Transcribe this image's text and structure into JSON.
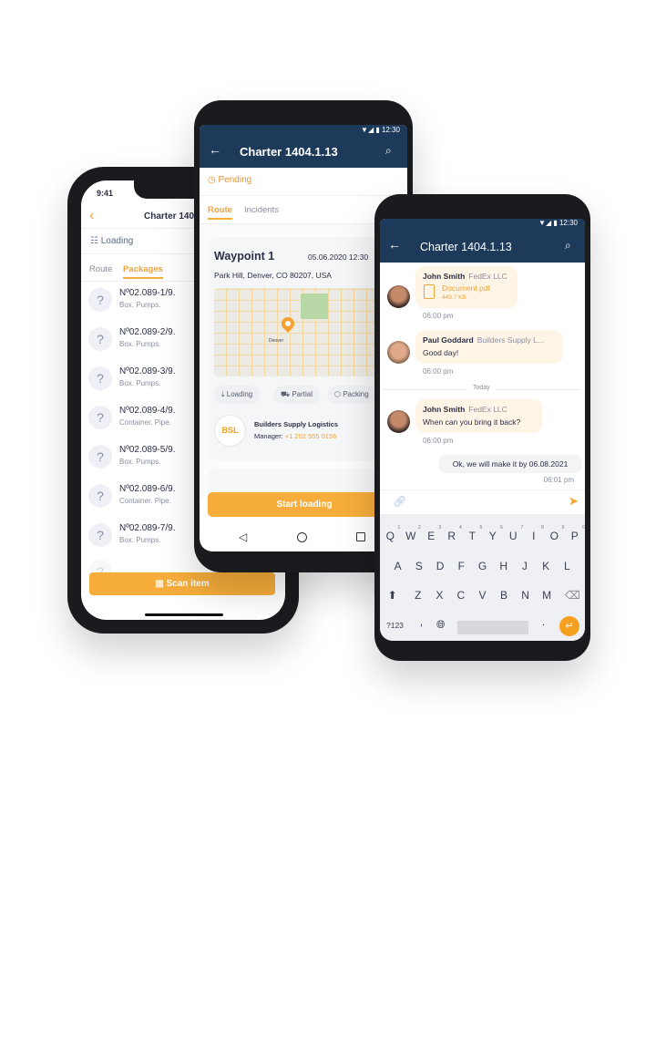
{
  "colors": {
    "accent": "#f6ad3b",
    "header": "#1d3a5b",
    "text": "#2a2f45",
    "muted": "#8a8fa3",
    "bubble": "#fff5e6"
  },
  "left_phone": {
    "time": "9:41",
    "title": "Charter 1404.1.13",
    "status": "Loading",
    "tabs": [
      {
        "label": "Route",
        "active": false
      },
      {
        "label": "Packages",
        "active": true
      }
    ],
    "packages": [
      {
        "id": "Nº02.089-1/9.",
        "desc": "Box. Pumps."
      },
      {
        "id": "Nº02.089-2/9.",
        "desc": "Box. Pumps."
      },
      {
        "id": "Nº02.089-3/9.",
        "desc": "Box. Pumps."
      },
      {
        "id": "Nº02.089-4/9.",
        "desc": "Container. Pipe."
      },
      {
        "id": "Nº02.089-5/9.",
        "desc": "Box. Pumps."
      },
      {
        "id": "Nº02.089-6/9.",
        "desc": "Container. Pipe."
      },
      {
        "id": "Nº02.089-7/9.",
        "desc": "Box. Pumps."
      }
    ],
    "scan_button": "Scan item"
  },
  "middle_phone": {
    "status_time": "12:30",
    "title": "Charter 1404.1.13",
    "status": "Pending",
    "tabs": [
      {
        "label": "Route",
        "active": true
      },
      {
        "label": "Incidents",
        "active": false
      }
    ],
    "waypoint": {
      "name": "Waypoint 1",
      "datetime": "05.06.2020 12:30",
      "address": "Park Hill, Denver, CO 80207, USA",
      "map_label": "Denver",
      "chips": [
        "Loading",
        "Partial",
        "Packing"
      ],
      "company": "Builders Supply Logistics",
      "manager_label": "Manager:",
      "manager_phone": "+1 202 555 0156",
      "logo": "BSL"
    },
    "start_button": "Start loading"
  },
  "right_phone": {
    "status_time": "12:30",
    "title": "Charter 1404.1.13",
    "messages": [
      {
        "name": "John Smith",
        "company": "FedEx LLC",
        "file": "Document.pdf",
        "size": "449.7 KB",
        "time": "06:00 pm"
      },
      {
        "name": "Paul Goddard",
        "company": "Builders Supply L...",
        "text": "Good day!",
        "time": "06:00 pm"
      },
      {
        "name": "John Smith",
        "company": "FedEx LLC",
        "text": "When can you bring it back?",
        "time": "06:00 pm"
      }
    ],
    "day_divider": "Today",
    "own_message": {
      "text": "Ok, we will make it by 06.08.2021",
      "time": "06:01 pm"
    },
    "keyboard": {
      "row1": [
        "Q",
        "W",
        "E",
        "R",
        "T",
        "Y",
        "U",
        "I",
        "O",
        "P"
      ],
      "row1_nums": [
        "1",
        "2",
        "3",
        "4",
        "5",
        "6",
        "7",
        "8",
        "9",
        "0"
      ],
      "row2": [
        "A",
        "S",
        "D",
        "F",
        "G",
        "H",
        "J",
        "K",
        "L"
      ],
      "row3": [
        "Z",
        "X",
        "C",
        "V",
        "B",
        "N",
        "M"
      ],
      "sym": "?123",
      "comma": ",",
      "period": "."
    }
  }
}
